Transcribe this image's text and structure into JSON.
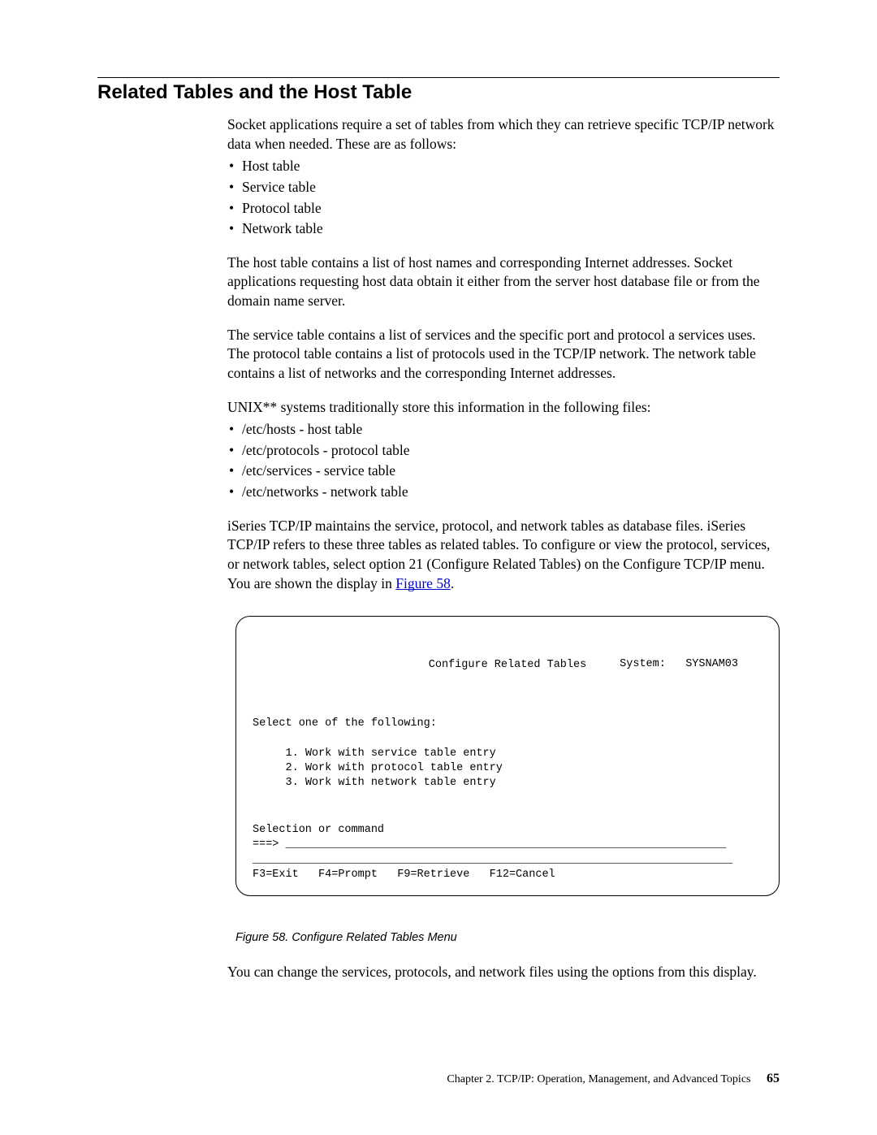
{
  "section_title": "Related Tables and the Host Table",
  "intro_para": "Socket applications require a set of tables from which they can retrieve specific TCP/IP network data when needed. These are as follows:",
  "tables_list": [
    "Host table",
    "Service table",
    "Protocol table",
    "Network table"
  ],
  "host_para": "The host table contains a list of host names and corresponding Internet addresses. Socket applications requesting host data obtain it either from the server host database file or from the domain name server.",
  "service_para": "The service table contains a list of services and the specific port and protocol a services uses. The protocol table contains a list of protocols used in the TCP/IP network. The network table contains a list of networks and the corresponding Internet addresses.",
  "unix_para": "UNIX** systems traditionally store this information in the following files:",
  "files_list": [
    "/etc/hosts - host table",
    "/etc/protocols - protocol table",
    "/etc/services - service table",
    "/etc/networks - network table"
  ],
  "iseries_para_prefix": "iSeries TCP/IP maintains the service, protocol, and network tables as database files. iSeries TCP/IP refers to these three tables as related tables. To configure or view the protocol, services, or network tables, select option 21 (Configure Related Tables) on the Configure TCP/IP menu. You are shown the display in ",
  "iseries_para_link": "Figure 58",
  "iseries_para_suffix": ".",
  "terminal": {
    "title": "Configure Related Tables",
    "system_label": "System:",
    "system_value": "SYSNAM03",
    "prompt": "Select one of the following:",
    "options": [
      "1. Work with service table entry",
      "2. Work with protocol table entry",
      "3. Work with network table entry"
    ],
    "selection_label": "Selection or command",
    "cmd_prefix": "===>",
    "cmd_underline": " ___________________________________________________________________",
    "divider": "_________________________________________________________________________",
    "fkeys": "F3=Exit   F4=Prompt   F9=Retrieve   F12=Cancel"
  },
  "figure_caption": "Figure 58. Configure Related Tables Menu",
  "closing_para": "You can change the services, protocols, and network files using the options from this display.",
  "footer_text": "Chapter 2. TCP/IP: Operation, Management, and Advanced Topics",
  "page_number": "65"
}
